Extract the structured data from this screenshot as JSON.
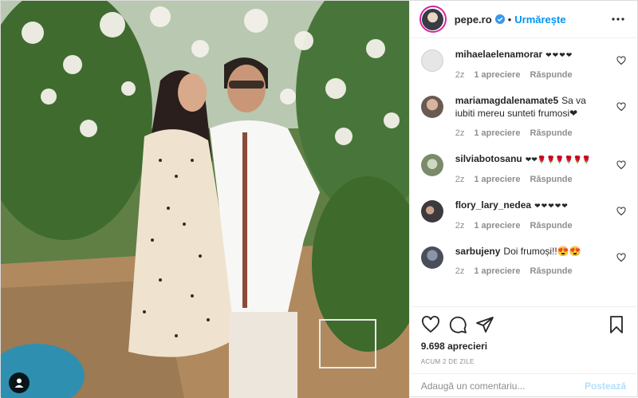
{
  "header": {
    "username": "pepe.ro",
    "separator": "•",
    "follow_label": "Urmărește",
    "more_icon": "more-horizontal-icon"
  },
  "comments": [
    {
      "username": "mihaelaelenamorar",
      "text": "❤❤❤❤",
      "age": "2z",
      "likes": "1 apreciere",
      "reply": "Răspunde",
      "avatar_color": "#e6e6e6"
    },
    {
      "username": "mariamagdalenamate5",
      "text": "Sa va iubiti mereu sunteti frumosi❤",
      "age": "2z",
      "likes": "1 apreciere",
      "reply": "Răspunde",
      "avatar_color": "#6b5a52"
    },
    {
      "username": "silviabotosanu",
      "text": "❤❤🌹🌹🌹🌹🌹🌹",
      "age": "2z",
      "likes": "1 apreciere",
      "reply": "Răspunde",
      "avatar_color": "#7a8a6a"
    },
    {
      "username": "flory_lary_nedea",
      "text": "❤❤❤❤❤",
      "age": "2z",
      "likes": "1 apreciere",
      "reply": "Răspunde",
      "avatar_color": "#3d3a3f"
    },
    {
      "username": "sarbujeny",
      "text": "Doi frumoși!!😍😍",
      "age": "2z",
      "likes": "1 apreciere",
      "reply": "Răspunde",
      "avatar_color": "#4a4e5a"
    }
  ],
  "stats": {
    "likes": "9.698 aprecieri",
    "posted_ago": "ACUM 2 DE ZILE"
  },
  "add_comment": {
    "placeholder": "Adaugă un comentariu...",
    "post_label": "Postează"
  },
  "colors": {
    "follow": "#0095f6",
    "post_disabled": "#b2dffc",
    "meta": "#8e8e8e"
  }
}
